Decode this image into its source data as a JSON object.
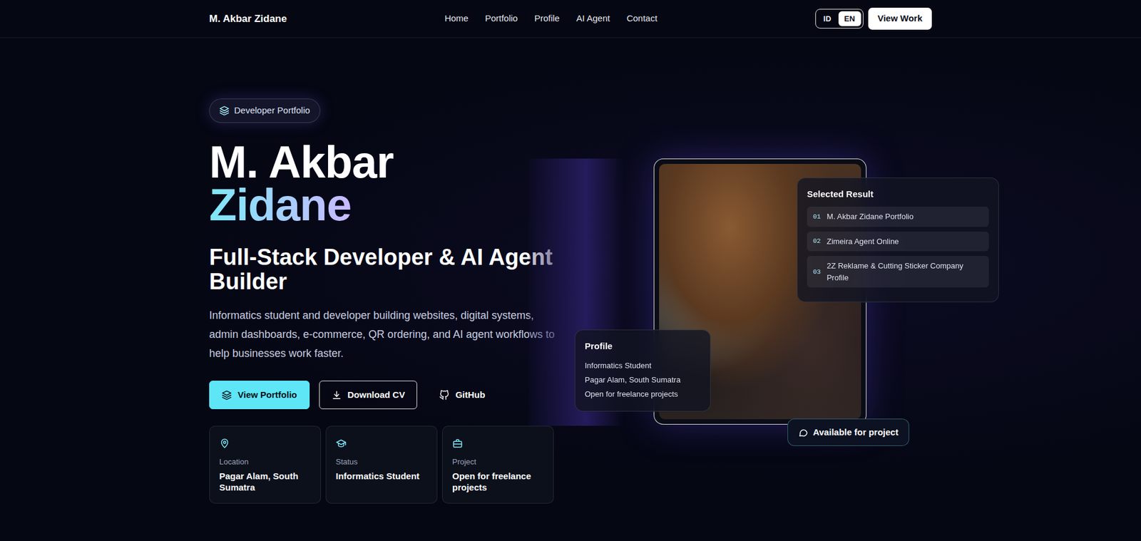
{
  "navbar": {
    "brand": "M. Akbar Zidane",
    "links": [
      {
        "label": "Home"
      },
      {
        "label": "Portfolio"
      },
      {
        "label": "Profile"
      },
      {
        "label": "AI Agent"
      },
      {
        "label": "Contact"
      }
    ],
    "languages": [
      {
        "label": "ID",
        "selected": false
      },
      {
        "label": "EN",
        "selected": true
      }
    ],
    "cta": "View Work"
  },
  "hero": {
    "badge": "Developer Portfolio",
    "title_line1": "M. Akbar",
    "title_line2": "Zidane",
    "subtitle": "Full-Stack Developer & AI Agent Builder",
    "description": "Informatics student and developer building websites, digital systems, admin dashboards, e-commerce, QR ordering, and AI agent workflows to help businesses work faster.",
    "buttons": [
      {
        "label": "View Portfolio",
        "kind": "primary"
      },
      {
        "label": "Download CV",
        "kind": "outline"
      },
      {
        "label": "GitHub",
        "kind": "link"
      }
    ],
    "info_cards": [
      {
        "label": "Location",
        "value": "Pagar Alam, South Sumatra"
      },
      {
        "label": "Status",
        "value": "Informatics Student"
      },
      {
        "label": "Project",
        "value": "Open for freelance projects"
      }
    ]
  },
  "showcase": {
    "selected_result": {
      "title": "Selected Result",
      "items": [
        {
          "number": "01",
          "label": "M. Akbar Zidane Portfolio"
        },
        {
          "number": "02",
          "label": "Zimeira Agent Online"
        },
        {
          "number": "03",
          "label": "2Z Reklame & Cutting Sticker Company Profile"
        }
      ]
    },
    "profile_card": {
      "title": "Profile",
      "lines": [
        "Informatics Student",
        "Pagar Alam, South Sumatra",
        "Open for freelance projects"
      ]
    },
    "availability": "Available for project"
  }
}
